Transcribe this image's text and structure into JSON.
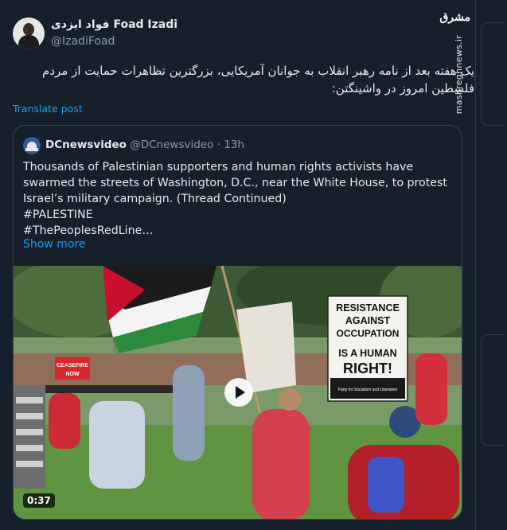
{
  "author": {
    "display_name": "فواد ایزدی Foad Izadi",
    "handle": "@IzadiFoad"
  },
  "tweet": {
    "text": "یک هفته بعد از نامه رهبر انقلاب به جوانان آمریکایی، بزرگترین تظاهرات حمایت از مردم فلسطین امروز در واشینگتن:",
    "translate_label": "Translate post"
  },
  "watermark": {
    "logo_text": "مشرق",
    "site": "mashreghnews.ir"
  },
  "quoted_post": {
    "display_name": "DCnewsvideo",
    "handle": "@DCnewsvideo",
    "separator": "·",
    "time": "13h",
    "lines": [
      "Thousands of Palestinian supporters and human rights activists have",
      "swarmed the streets of Washington, D.C., near the White House, to protest",
      "Israel’s military campaign. (Thread Continued)",
      "#PALESTINE",
      "#ThePeoplesRedLine…"
    ],
    "show_more": "Show more",
    "video": {
      "duration": "0:37",
      "signs": {
        "ceasefire_1": "CEASEFIRE",
        "ceasefire_2": "NOW",
        "resist_1": "RESISTANCE",
        "resist_2": "AGAINST",
        "resist_3": "OCCUPATION",
        "human_1": "IS A HUMAN",
        "human_2": "RIGHT!",
        "org": "Party for Socialism and Liberation"
      }
    }
  },
  "colors": {
    "background": "#15202b",
    "link": "#1d9bf0",
    "border": "#38444d",
    "text": "#e7e9ea",
    "muted": "#8b98a5"
  }
}
